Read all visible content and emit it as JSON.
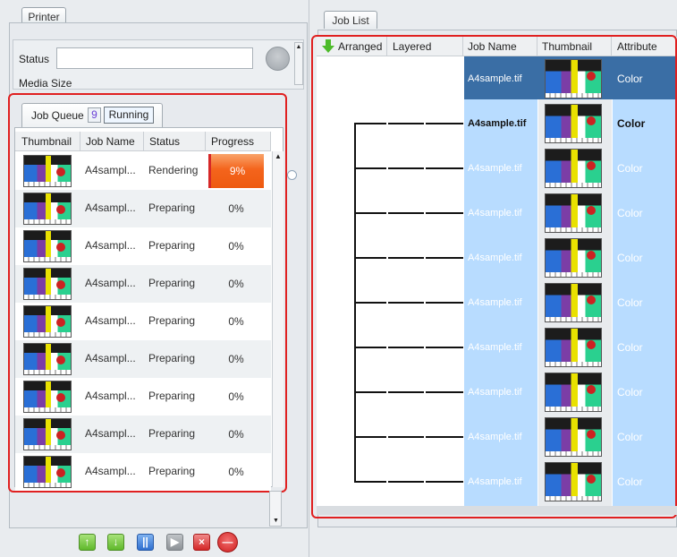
{
  "printer_tab": "Printer",
  "printer": {
    "status_label": "Status",
    "status_value": "",
    "media_size_label": "Media Size"
  },
  "job_queue": {
    "tab_label": "Job Queue",
    "count": "9",
    "running_label": "Running",
    "columns": [
      "Thumbnail",
      "Job Name",
      "Status",
      "Progress"
    ],
    "rows": [
      {
        "job_name": "A4sampl...",
        "status": "Rendering",
        "progress": "9%"
      },
      {
        "job_name": "A4sampl...",
        "status": "Preparing",
        "progress": "0%"
      },
      {
        "job_name": "A4sampl...",
        "status": "Preparing",
        "progress": "0%"
      },
      {
        "job_name": "A4sampl...",
        "status": "Preparing",
        "progress": "0%"
      },
      {
        "job_name": "A4sampl...",
        "status": "Preparing",
        "progress": "0%"
      },
      {
        "job_name": "A4sampl...",
        "status": "Preparing",
        "progress": "0%"
      },
      {
        "job_name": "A4sampl...",
        "status": "Preparing",
        "progress": "0%"
      },
      {
        "job_name": "A4sampl...",
        "status": "Preparing",
        "progress": "0%"
      },
      {
        "job_name": "A4sampl...",
        "status": "Preparing",
        "progress": "0%"
      }
    ]
  },
  "action_buttons": [
    {
      "name": "move-up-button",
      "glyph": "↑"
    },
    {
      "name": "move-down-button",
      "glyph": "↓"
    },
    {
      "name": "pause-button",
      "glyph": "||"
    },
    {
      "name": "play-button",
      "glyph": "▶"
    },
    {
      "name": "delete-button",
      "glyph": "×"
    },
    {
      "name": "cancel-button",
      "glyph": "—"
    }
  ],
  "job_list": {
    "tab_label": "Job List",
    "columns": [
      "Arranged",
      "Layered",
      "Job Name",
      "Thumbnail",
      "Attribute"
    ],
    "rows": [
      {
        "job_name": "A4sample.tif",
        "attribute": "Color"
      },
      {
        "job_name": "A4sample.tif",
        "attribute": "Color"
      },
      {
        "job_name": "A4sample.tif",
        "attribute": "Color"
      },
      {
        "job_name": "A4sample.tif",
        "attribute": "Color"
      },
      {
        "job_name": "A4sample.tif",
        "attribute": "Color"
      },
      {
        "job_name": "A4sample.tif",
        "attribute": "Color"
      },
      {
        "job_name": "A4sample.tif",
        "attribute": "Color"
      },
      {
        "job_name": "A4sample.tif",
        "attribute": "Color"
      },
      {
        "job_name": "A4sample.tif",
        "attribute": "Color"
      },
      {
        "job_name": "A4sample.tif",
        "attribute": "Color"
      }
    ]
  },
  "colors": {
    "highlight_frame": "#e02020",
    "selected_row": "#3a6ea5",
    "column_fill": "#b8dcff",
    "progress_active": "#f4641c"
  }
}
